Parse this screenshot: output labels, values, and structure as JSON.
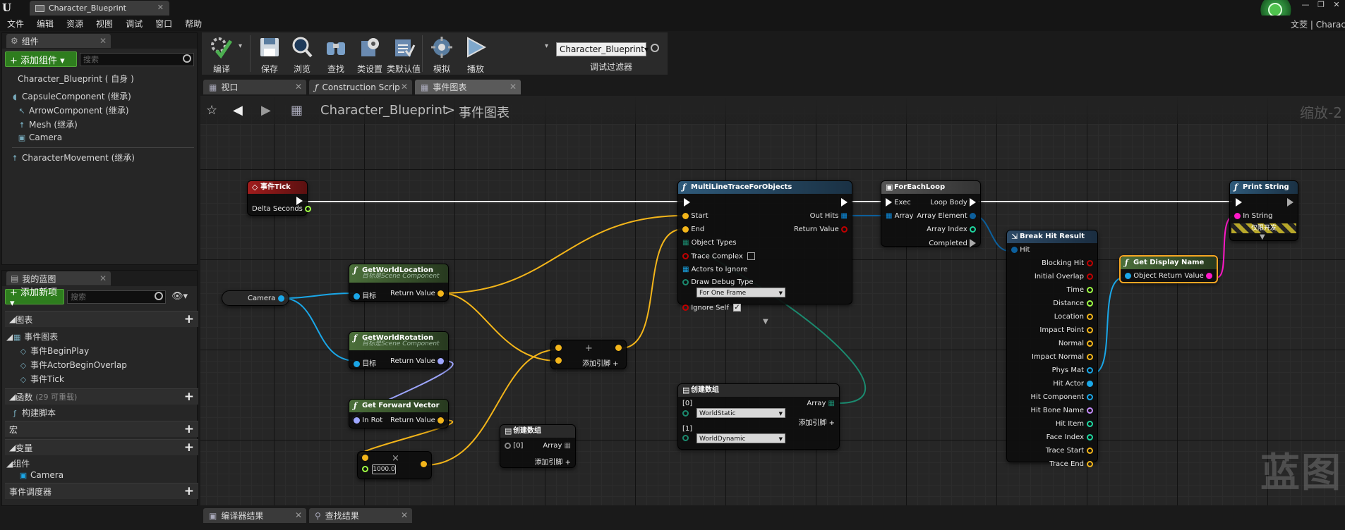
{
  "window": {
    "tab_title": "Character_Blueprint",
    "user_name": "文茭",
    "right_title": "Characte"
  },
  "menu": [
    "文件",
    "编辑",
    "资源",
    "视图",
    "调试",
    "窗口",
    "帮助"
  ],
  "components_panel": {
    "tab_label": "组件",
    "add_button": "+ 添加组件 ▾",
    "search_placeholder": "搜索",
    "root": "Character_Blueprint ( 自身 )",
    "items": [
      "CapsuleComponent (继承)",
      "ArrowComponent (继承)",
      "Mesh (继承)",
      "Camera",
      "CharacterMovement (继承)"
    ]
  },
  "my_blueprint_panel": {
    "tab_label": "我的蓝图",
    "add_button": "+ 添加新项 ▾",
    "search_placeholder": "搜索",
    "graphs_label": "图表",
    "event_graph_label": "事件图表",
    "events": [
      "事件BeginPlay",
      "事件ActorBeginOverlap",
      "事件Tick"
    ],
    "functions_label": "函数",
    "functions_count": "(29 可重载)",
    "construction_script": "构建脚本",
    "macros_label": "宏",
    "variables_label": "变量",
    "components_label": "组件",
    "camera_var": "Camera",
    "event_dispatchers_label": "事件调度器"
  },
  "toolbar": {
    "compile": "编译",
    "save": "保存",
    "browse": "浏览",
    "find": "查找",
    "class_settings": "类设置",
    "class_defaults": "类默认值",
    "simulate": "模拟",
    "play": "播放",
    "debug_object": "Character_Blueprint▾",
    "debug_filter": "调试过滤器"
  },
  "editor_tabs": [
    "视口",
    "Construction Scrip",
    "事件图表"
  ],
  "graph": {
    "breadcrumb_bp": "Character_Blueprint",
    "breadcrumb_sep": ">",
    "breadcrumb_graph": "事件图表",
    "zoom_label": "缩放-2",
    "watermark": "蓝图"
  },
  "nodes": {
    "event_tick": {
      "title": "事件Tick",
      "delta": "Delta Seconds"
    },
    "camera": {
      "label": "Camera"
    },
    "get_world_location": {
      "title": "GetWorldLocation",
      "subtitle": "目标是Scene Component",
      "target": "目标",
      "ret": "Return Value"
    },
    "get_world_rotation": {
      "title": "GetWorldRotation",
      "subtitle": "目标是Scene Component",
      "target": "目标",
      "ret": "Return Value"
    },
    "get_forward_vector": {
      "title": "Get Forward Vector",
      "in_rot": "In Rot",
      "ret": "Return Value"
    },
    "multiply": {
      "value": "1000.0",
      "symbol": "×"
    },
    "add": {
      "symbol": "+",
      "add_pin": "添加引脚 +"
    },
    "make_array_small": {
      "title": "创建数组",
      "pin0": "[0]",
      "array": "Array",
      "add_pin": "添加引脚 +"
    },
    "multi_trace": {
      "title": "MultiLineTraceForObjects",
      "start": "Start",
      "end": "End",
      "object_types": "Object Types",
      "trace_complex": "Trace Complex",
      "actors_to_ignore": "Actors to Ignore",
      "draw_debug_type": "Draw Debug Type",
      "draw_debug_value": "For One Frame",
      "ignore_self": "Ignore Self",
      "out_hits": "Out Hits",
      "return_value": "Return Value"
    },
    "make_array_big": {
      "title": "创建数组",
      "pin0": "[0]",
      "pin0_value": "WorldStatic",
      "pin1": "[1]",
      "pin1_value": "WorldDynamic",
      "array": "Array",
      "add_pin": "添加引脚 +"
    },
    "foreach": {
      "title": "ForEachLoop",
      "exec": "Exec",
      "array": "Array",
      "loop_body": "Loop Body",
      "array_element": "Array Element",
      "array_index": "Array Index",
      "completed": "Completed"
    },
    "break_hit": {
      "title": "Break Hit Result",
      "hit": "Hit",
      "outputs": [
        "Blocking Hit",
        "Initial Overlap",
        "Time",
        "Distance",
        "Location",
        "Impact Point",
        "Normal",
        "Impact Normal",
        "Phys Mat",
        "Hit Actor",
        "Hit Component",
        "Hit Bone Name",
        "Hit Item",
        "Face Index",
        "Trace Start",
        "Trace End"
      ]
    },
    "get_display_name": {
      "title": "Get Display Name",
      "object": "Object",
      "ret": "Return Value"
    },
    "print_string": {
      "title": "Print String",
      "in_string": "In String",
      "dev_only": "仅限开发"
    }
  },
  "bottom_tabs": [
    "编译器结果",
    "查找结果"
  ],
  "colors": {
    "exec": "#ffffff",
    "object_pin": "#1aa7e8",
    "vector_pin": "#f3b51a",
    "rotator_pin": "#9ea6ff",
    "float_pin": "#9fff44",
    "bool_pin": "#c00000",
    "string_pin": "#ff19c8",
    "struct_pin": "#0c5f9c",
    "teal_wire": "#1b8a6f",
    "event_header": "#a01c1c",
    "pure_header": "#4b6f3a",
    "function_header": "#2f5a7a",
    "selected_outline": "#f5a623"
  }
}
